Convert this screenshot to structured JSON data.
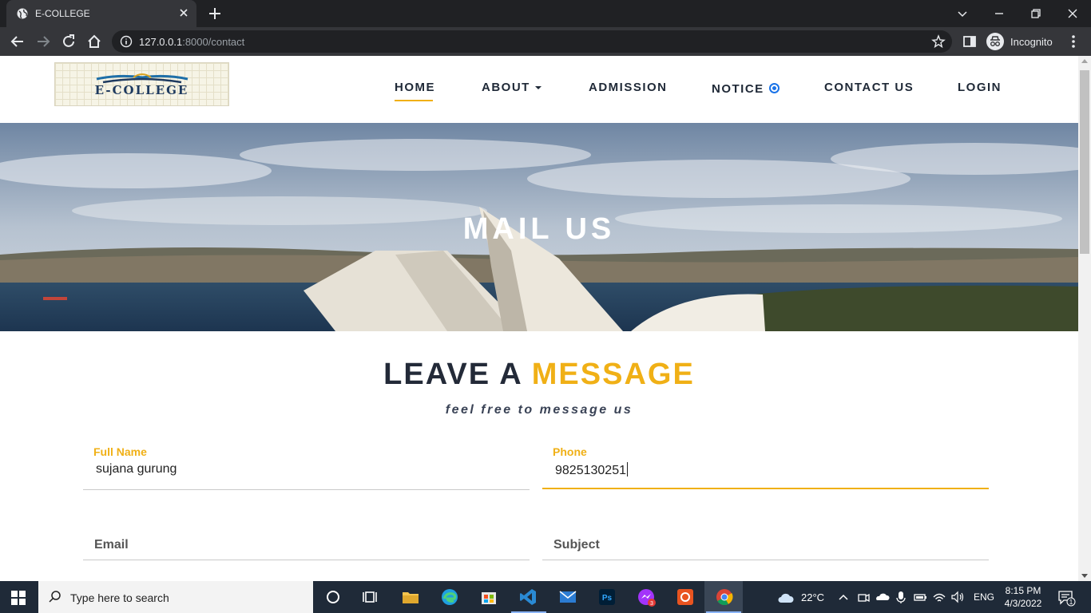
{
  "browser": {
    "tab_title": "E-COLLEGE",
    "url_host": "127.0.0.1",
    "url_rest": ":8000/contact",
    "profile_label": "Incognito"
  },
  "site": {
    "logo_text": "E-COLLEGE",
    "nav": {
      "home": "HOME",
      "about": "ABOUT",
      "admission": "ADMISSION",
      "notice": "NOTICE",
      "contact": "CONTACT US",
      "login": "LOGIN"
    },
    "hero_title": "MAIL US",
    "section_title_main": "LEAVE A ",
    "section_title_accent": "MESSAGE",
    "section_subtitle": "feel free to message us",
    "form": {
      "full_name_label": "Full Name",
      "full_name_value": "sujana gurung",
      "phone_label": "Phone",
      "phone_value": "9825130251",
      "email_placeholder": "Email",
      "subject_placeholder": "Subject"
    },
    "colors": {
      "accent": "#f0b016",
      "heading": "#232a38"
    }
  },
  "taskbar": {
    "search_placeholder": "Type here to search",
    "weather": "22°C",
    "language": "ENG",
    "time": "8:15 PM",
    "date": "4/3/2022",
    "notification_count": "1",
    "badge_count": "3"
  }
}
